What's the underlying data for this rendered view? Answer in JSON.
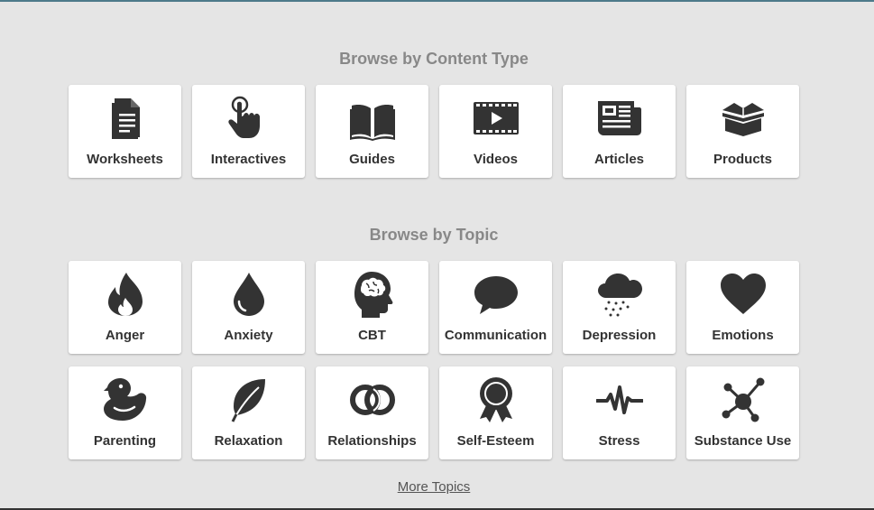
{
  "content_section": {
    "title": "Browse by Content Type",
    "items": [
      {
        "label": "Worksheets",
        "icon": "document-icon"
      },
      {
        "label": "Interactives",
        "icon": "pointing-hand-icon"
      },
      {
        "label": "Guides",
        "icon": "open-book-icon"
      },
      {
        "label": "Videos",
        "icon": "film-play-icon"
      },
      {
        "label": "Articles",
        "icon": "newspaper-icon"
      },
      {
        "label": "Products",
        "icon": "open-box-icon"
      }
    ]
  },
  "topic_section": {
    "title": "Browse by Topic",
    "items": [
      {
        "label": "Anger",
        "icon": "fire-icon"
      },
      {
        "label": "Anxiety",
        "icon": "droplet-icon"
      },
      {
        "label": "CBT",
        "icon": "head-brain-icon"
      },
      {
        "label": "Communication",
        "icon": "speech-bubble-icon"
      },
      {
        "label": "Depression",
        "icon": "rain-cloud-icon"
      },
      {
        "label": "Emotions",
        "icon": "heart-icon"
      },
      {
        "label": "Parenting",
        "icon": "rubber-duck-icon"
      },
      {
        "label": "Relaxation",
        "icon": "leaf-icon"
      },
      {
        "label": "Relationships",
        "icon": "interlocked-rings-icon"
      },
      {
        "label": "Self-Esteem",
        "icon": "award-ribbon-icon"
      },
      {
        "label": "Stress",
        "icon": "pulse-icon"
      },
      {
        "label": "Substance Use",
        "icon": "molecule-icon"
      }
    ]
  },
  "more_link": "More Topics",
  "colors": {
    "background": "#e5e5e5",
    "tile": "#ffffff",
    "icon": "#333333",
    "heading": "#888888"
  }
}
